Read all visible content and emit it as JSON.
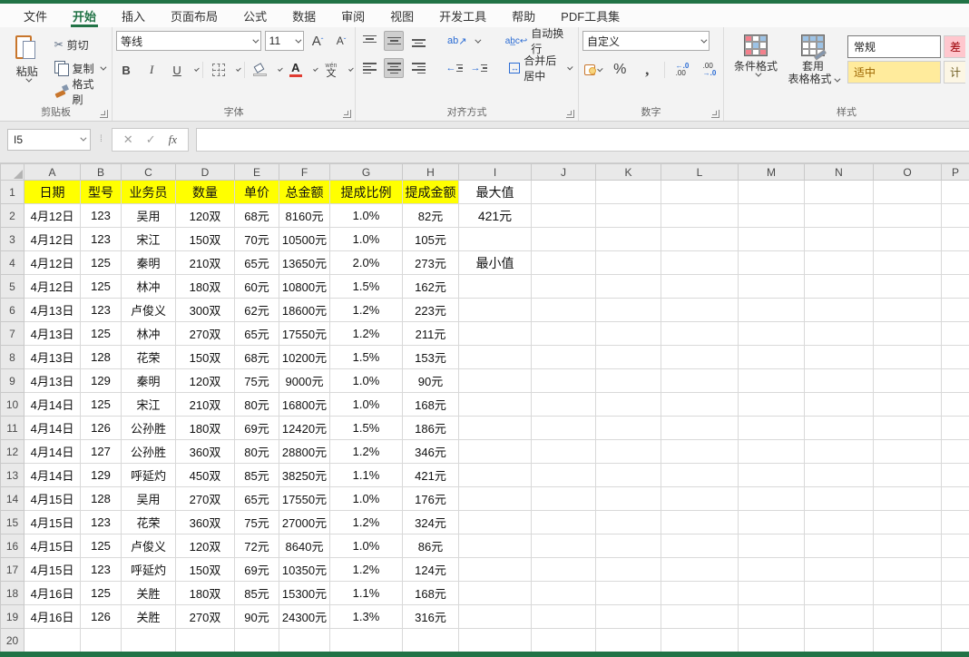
{
  "menu": {
    "tabs": [
      "文件",
      "开始",
      "插入",
      "页面布局",
      "公式",
      "数据",
      "审阅",
      "视图",
      "开发工具",
      "帮助",
      "PDF工具集"
    ],
    "active": "开始"
  },
  "ribbon": {
    "clipboard": {
      "group_label": "剪贴板",
      "paste": "粘贴",
      "cut": "剪切",
      "copy": "复制",
      "format_painter": "格式刷"
    },
    "font": {
      "group_label": "字体",
      "font_name": "等线",
      "font_size": "11",
      "bold": "B",
      "italic": "I",
      "underline": "U",
      "grow": "A",
      "shrink": "A",
      "font_color": "A",
      "phonetic_top": "wén",
      "phonetic": "文"
    },
    "alignment": {
      "group_label": "对齐方式",
      "wrap_text": "自动换行",
      "merge_center": "合并后居中",
      "orientation": "ab"
    },
    "number": {
      "group_label": "数字",
      "format": "自定义",
      "percent": "%",
      "comma": "9",
      "inc_top": "←.0",
      "inc_bot": ".00",
      "dec_top": ".00",
      "dec_bot": "→.0"
    },
    "styles": {
      "group_label": "样式",
      "conditional": "条件格式",
      "format_table_1": "套用",
      "format_table_2": "表格格式",
      "gallery": [
        {
          "label": "常规",
          "bg": "#ffffff",
          "color": "#1a1a1a",
          "selected": true
        },
        {
          "label": "差",
          "bg": "#ffc7ce",
          "color": "#9c0006",
          "selected": false
        },
        {
          "label": "适中",
          "bg": "#ffeb9c",
          "color": "#9c6500",
          "selected": false
        },
        {
          "label": "计",
          "bg": "#fcf6e4",
          "color": "#6b5a1e",
          "selected": false
        }
      ]
    }
  },
  "formula_bar": {
    "name_box": "I5",
    "cancel": "✕",
    "enter": "✓",
    "fx": "fx",
    "formula": ""
  },
  "sheet": {
    "col_letters": [
      "A",
      "B",
      "C",
      "D",
      "E",
      "F",
      "G",
      "H",
      "I",
      "J",
      "K",
      "L",
      "M",
      "N",
      "O",
      "P"
    ],
    "header_cells": [
      "日期",
      "型号",
      "业务员",
      "数量",
      "单价",
      "总金额",
      "提成比例",
      "提成金额"
    ],
    "header_fill": "#ffff00",
    "rows": [
      [
        "4月12日",
        "123",
        "吴用",
        "120双",
        "68元",
        "8160元",
        "1.0%",
        "82元"
      ],
      [
        "4月12日",
        "123",
        "宋江",
        "150双",
        "70元",
        "10500元",
        "1.0%",
        "105元"
      ],
      [
        "4月12日",
        "125",
        "秦明",
        "210双",
        "65元",
        "13650元",
        "2.0%",
        "273元"
      ],
      [
        "4月12日",
        "125",
        "林冲",
        "180双",
        "60元",
        "10800元",
        "1.5%",
        "162元"
      ],
      [
        "4月13日",
        "123",
        "卢俊义",
        "300双",
        "62元",
        "18600元",
        "1.2%",
        "223元"
      ],
      [
        "4月13日",
        "125",
        "林冲",
        "270双",
        "65元",
        "17550元",
        "1.2%",
        "211元"
      ],
      [
        "4月13日",
        "128",
        "花荣",
        "150双",
        "68元",
        "10200元",
        "1.5%",
        "153元"
      ],
      [
        "4月13日",
        "129",
        "秦明",
        "120双",
        "75元",
        "9000元",
        "1.0%",
        "90元"
      ],
      [
        "4月14日",
        "125",
        "宋江",
        "210双",
        "80元",
        "16800元",
        "1.0%",
        "168元"
      ],
      [
        "4月14日",
        "126",
        "公孙胜",
        "180双",
        "69元",
        "12420元",
        "1.5%",
        "186元"
      ],
      [
        "4月14日",
        "127",
        "公孙胜",
        "360双",
        "80元",
        "28800元",
        "1.2%",
        "346元"
      ],
      [
        "4月14日",
        "129",
        "呼延灼",
        "450双",
        "85元",
        "38250元",
        "1.1%",
        "421元"
      ],
      [
        "4月15日",
        "128",
        "吴用",
        "270双",
        "65元",
        "17550元",
        "1.0%",
        "176元"
      ],
      [
        "4月15日",
        "123",
        "花荣",
        "360双",
        "75元",
        "27000元",
        "1.2%",
        "324元"
      ],
      [
        "4月15日",
        "125",
        "卢俊义",
        "120双",
        "72元",
        "8640元",
        "1.0%",
        "86元"
      ],
      [
        "4月15日",
        "123",
        "呼延灼",
        "150双",
        "69元",
        "10350元",
        "1.2%",
        "124元"
      ],
      [
        "4月16日",
        "125",
        "关胜",
        "180双",
        "85元",
        "15300元",
        "1.1%",
        "168元"
      ],
      [
        "4月16日",
        "126",
        "关胜",
        "270双",
        "90元",
        "24300元",
        "1.3%",
        "316元"
      ]
    ],
    "extra_i_column": {
      "1": "最大值",
      "2": "421元",
      "4": "最小值"
    },
    "total_rows": 20
  },
  "colors": {
    "accent_green": "#217346",
    "header_yellow": "#ffff00"
  }
}
